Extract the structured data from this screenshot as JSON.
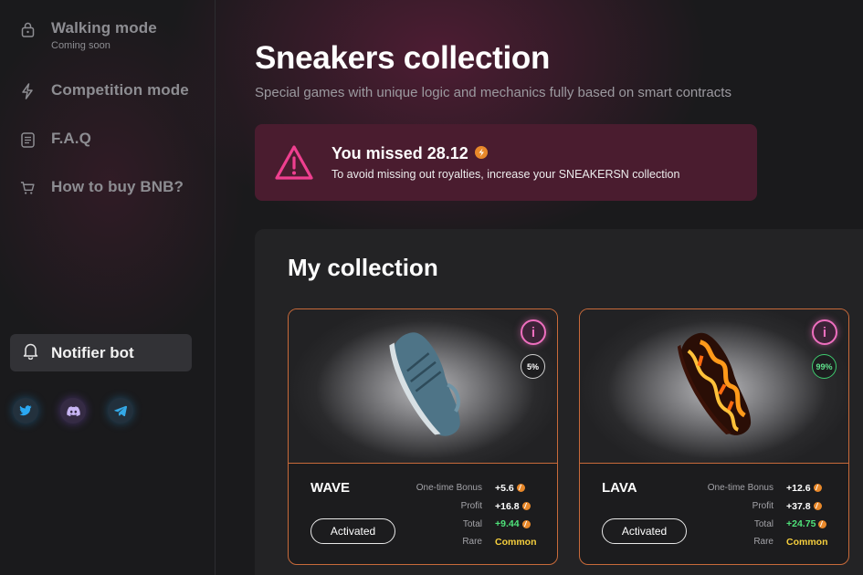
{
  "sidebar": {
    "items": [
      {
        "label": "Walking mode",
        "sub": "Coming soon",
        "icon": "lock-icon"
      },
      {
        "label": "Competition mode",
        "icon": "lightning-icon"
      },
      {
        "label": "F.A.Q",
        "icon": "document-icon"
      },
      {
        "label": "How to buy BNB?",
        "icon": "cart-icon"
      }
    ],
    "notifier": {
      "label": "Notifier bot",
      "icon": "bell-icon"
    },
    "socials": [
      {
        "name": "twitter-icon"
      },
      {
        "name": "discord-icon"
      },
      {
        "name": "telegram-icon"
      }
    ]
  },
  "main": {
    "title": "Sneakers collection",
    "subtitle": "Special games with unique logic and mechanics fully based on smart contracts",
    "alert": {
      "title": "You missed 28.12",
      "text": "To avoid missing out royalties, increase your SNEAKERSN collection",
      "icon": "warning-icon"
    },
    "collection": {
      "title": "My collection",
      "stat_labels": {
        "bonus": "One-time Bonus",
        "profit": "Profit",
        "total": "Total",
        "rare": "Rare"
      },
      "button_label": "Activated",
      "cards": [
        {
          "name": "WAVE",
          "percent": "5%",
          "bonus": "+5.6",
          "profit": "+16.8",
          "total": "+9.44",
          "rare": "Common"
        },
        {
          "name": "LAVA",
          "percent": "99%",
          "bonus": "+12.6",
          "profit": "+37.8",
          "total": "+24.75",
          "rare": "Common"
        }
      ]
    }
  },
  "colors": {
    "accent": "#ef3f8f",
    "card_border": "#c86a3a",
    "green": "#4fe27a",
    "rare": "#f6cf3d",
    "coin": "#e8882a"
  }
}
